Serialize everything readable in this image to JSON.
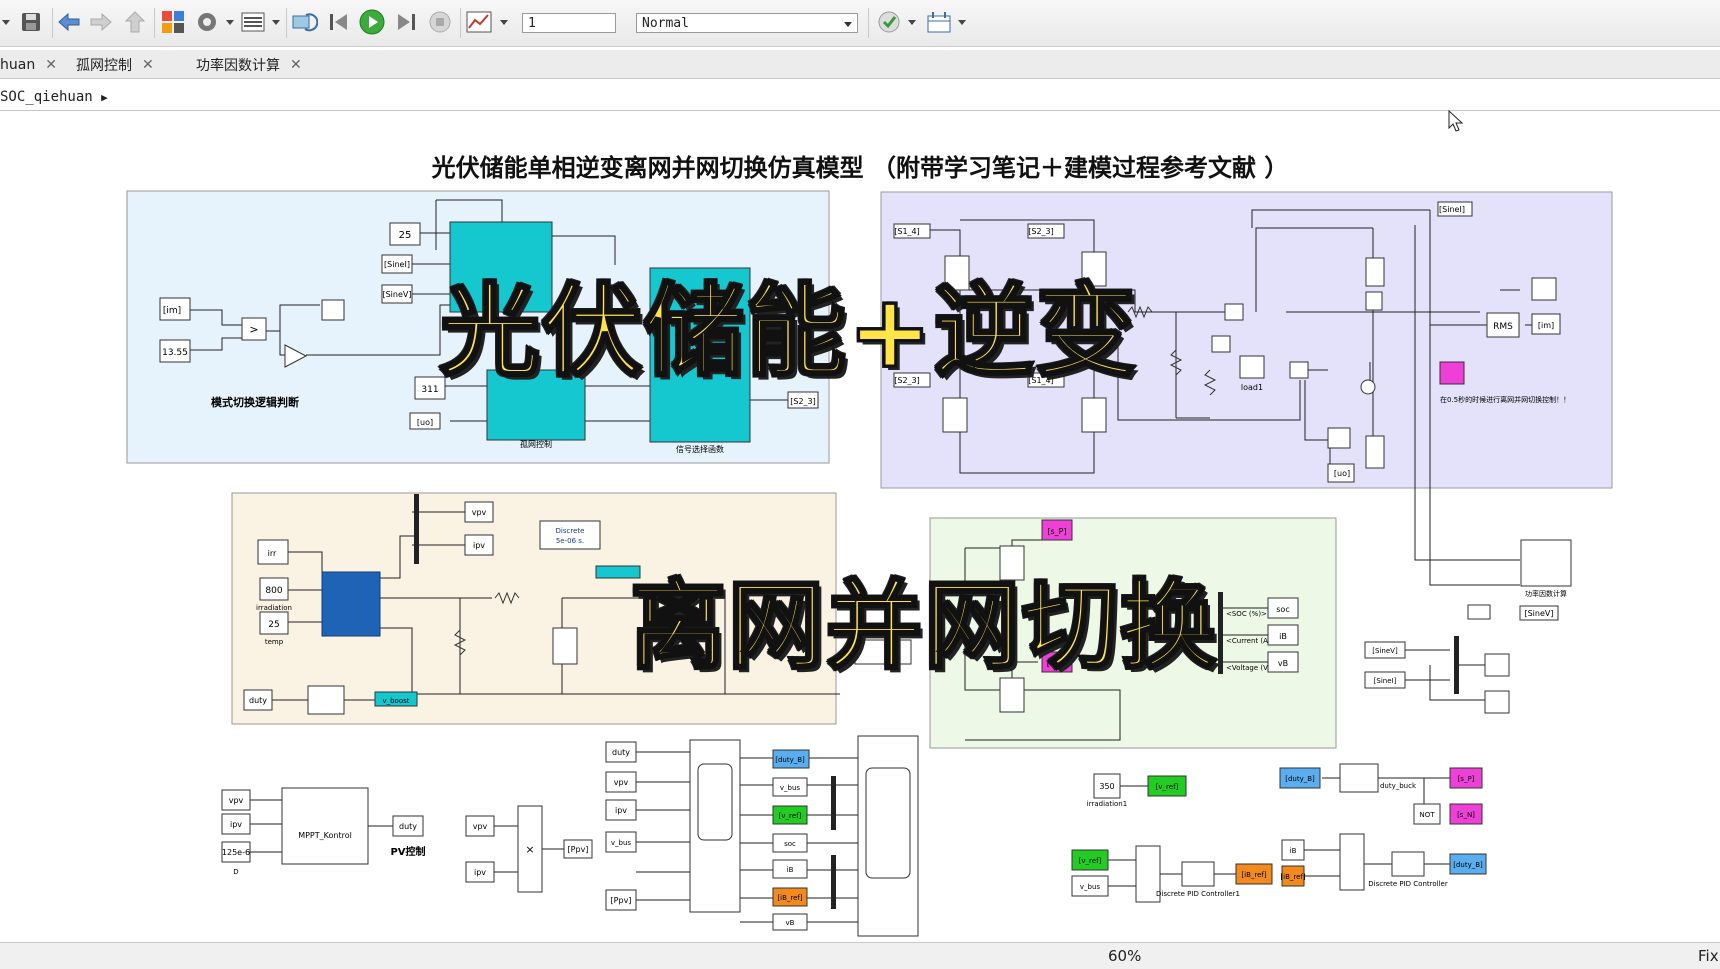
{
  "toolbar": {
    "stop_time": "1",
    "sim_mode": "Normal"
  },
  "tabs": [
    {
      "label": "huan"
    },
    {
      "label": "孤网控制"
    },
    {
      "label": "功率因数计算"
    }
  ],
  "breadcrumb": "SOC_qiehuan",
  "title": "光伏储能单相逆变离网并网切换仿真模型 （附带学习笔记＋建模过程参考文献 ）",
  "overlays": {
    "top": "光伏储能+逆变",
    "bottom": "离网并网切换"
  },
  "blocks": {
    "const_25": "25",
    "const_1355": "13.55",
    "const_311": "311",
    "const_800": "800",
    "const_25b": "25",
    "const_350": "350",
    "const_125e6": "125e-6",
    "goto_im": "[im]",
    "from_sinei": "[SineI]",
    "from_sinev": "[SineV]",
    "from_uo": "[uo]",
    "goto_s2_3": "[S2_3]",
    "from_s1_4": "[S1_4]",
    "from_s2_3": "[S2_3]",
    "from_s2_3b": "[S2_3]",
    "from_s1_4b": "[S1_4]",
    "goto_sinei": "[SineI]",
    "goto_sinev": "[SineV]",
    "goto_im2": "[im]",
    "goto_uo": "[uo]",
    "mode_label": "模式切换逻辑判断",
    "island_label": "孤网控制",
    "signal_label": "信号选择函数",
    "load_label": "load1",
    "rms_label": "RMS",
    "note_label": "在0.5秒的时候进行离网并网切换控制！！",
    "discrete": "Discrete\n5e-06 s.",
    "irr": "irr",
    "irradiation": "irradiation",
    "temp": "temp",
    "vpv": "vpv",
    "ipv": "ipv",
    "duty": "duty",
    "v_boost": "v_boost",
    "s_p": "[s_P]",
    "s_n": "[s_N]",
    "soc": "soc",
    "ib": "iB",
    "vb": "vB",
    "soc_port": "<SOC (%)>",
    "cur_port": "<Current (A)>",
    "volt_port": "<Voltage (V)>",
    "pf_label": "功率因数计算",
    "mppt": "MPPT_Kontrol",
    "pv_ctrl": "PV控制",
    "d_label": "D",
    "ppv": "[Ppv]",
    "pid1": "Discrete PID Controller1",
    "pid2": "Discrete PID Controller",
    "irradiation1": "irradiation1",
    "v_ref": "[v_ref]",
    "duty_b": "[duty_B]",
    "ib_ref": "[iB_ref]",
    "not": "NOT",
    "duty_buck": "duty_buck",
    "v_bus": "v_bus",
    "ibref": "iBref"
  },
  "status": {
    "zoom": "60%",
    "solver": "Fix"
  },
  "colors": {
    "region_control": "#e6f3fc",
    "region_inverter": "#e4e1fb",
    "region_pv": "#faf3e4",
    "region_battery": "#eef8e6",
    "cyan_block": "#15c7cf",
    "magenta_tag": "#ee3fd6",
    "green_tag": "#22cc22",
    "orange_tag": "#f28a1e",
    "blue_tag": "#5aaef0"
  }
}
